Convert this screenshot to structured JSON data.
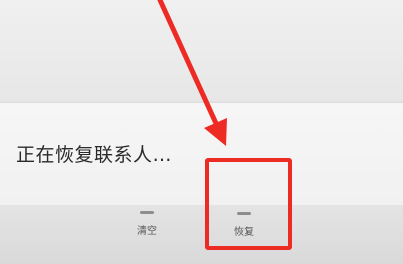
{
  "status": {
    "message": "正在恢复联系人…"
  },
  "bottom_bar": {
    "clear_label": "清空",
    "restore_label": "恢复"
  },
  "annotation": {
    "color": "#ee2a24",
    "icon": "red-arrow-pointer"
  }
}
